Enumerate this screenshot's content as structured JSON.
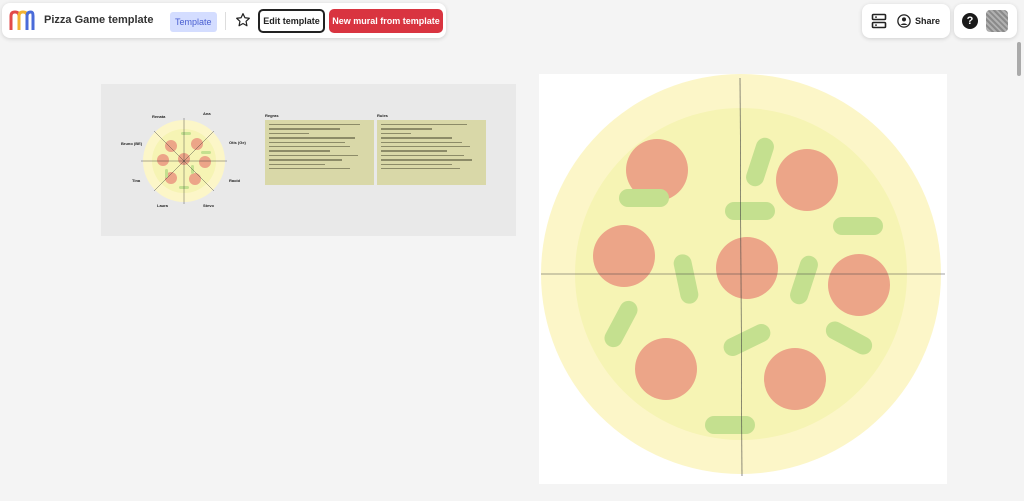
{
  "toolbar": {
    "title": "Pizza Game  template",
    "template_badge": "Template",
    "edit_label": "Edit template",
    "new_label": "New mural from template"
  },
  "right_toolbar": {
    "share_label": "Share"
  },
  "help": {
    "label": "?"
  },
  "board": {
    "mini_frame": {
      "names": [
        "Renata",
        "Ana",
        "Bruno (BE)",
        "Otis (Ge)",
        "Tina",
        "Raoid",
        "Laura",
        "Stevo"
      ],
      "notes": [
        {
          "title": "Regras"
        },
        {
          "title": "Rules"
        }
      ]
    }
  },
  "colors": {
    "brand_red": "#d93440",
    "badge_bg": "#d4ddff",
    "crust": "#fcf6c8",
    "cheese": "#f6f4b4",
    "pepperoni": "#eca588",
    "pepper": "#c4e08f"
  }
}
